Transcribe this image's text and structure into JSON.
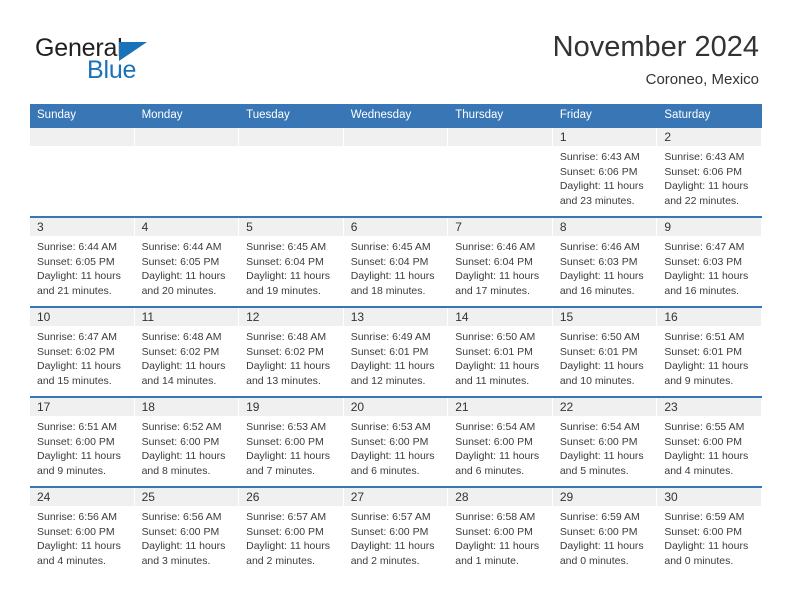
{
  "brand": {
    "name_part1": "General",
    "name_part2": "Blue",
    "triangle_color": "#1a73b8"
  },
  "header": {
    "title": "November 2024",
    "subtitle": "Coroneo, Mexico"
  },
  "calendar": {
    "accent_color": "#3876b5",
    "band_color": "#f0f0f0",
    "weekday_headers": [
      "Sunday",
      "Monday",
      "Tuesday",
      "Wednesday",
      "Thursday",
      "Friday",
      "Saturday"
    ],
    "weeks": [
      [
        {
          "day": "",
          "sunrise": "",
          "sunset": "",
          "daylight": ""
        },
        {
          "day": "",
          "sunrise": "",
          "sunset": "",
          "daylight": ""
        },
        {
          "day": "",
          "sunrise": "",
          "sunset": "",
          "daylight": ""
        },
        {
          "day": "",
          "sunrise": "",
          "sunset": "",
          "daylight": ""
        },
        {
          "day": "",
          "sunrise": "",
          "sunset": "",
          "daylight": ""
        },
        {
          "day": "1",
          "sunrise": "Sunrise: 6:43 AM",
          "sunset": "Sunset: 6:06 PM",
          "daylight": "Daylight: 11 hours and 23 minutes."
        },
        {
          "day": "2",
          "sunrise": "Sunrise: 6:43 AM",
          "sunset": "Sunset: 6:06 PM",
          "daylight": "Daylight: 11 hours and 22 minutes."
        }
      ],
      [
        {
          "day": "3",
          "sunrise": "Sunrise: 6:44 AM",
          "sunset": "Sunset: 6:05 PM",
          "daylight": "Daylight: 11 hours and 21 minutes."
        },
        {
          "day": "4",
          "sunrise": "Sunrise: 6:44 AM",
          "sunset": "Sunset: 6:05 PM",
          "daylight": "Daylight: 11 hours and 20 minutes."
        },
        {
          "day": "5",
          "sunrise": "Sunrise: 6:45 AM",
          "sunset": "Sunset: 6:04 PM",
          "daylight": "Daylight: 11 hours and 19 minutes."
        },
        {
          "day": "6",
          "sunrise": "Sunrise: 6:45 AM",
          "sunset": "Sunset: 6:04 PM",
          "daylight": "Daylight: 11 hours and 18 minutes."
        },
        {
          "day": "7",
          "sunrise": "Sunrise: 6:46 AM",
          "sunset": "Sunset: 6:04 PM",
          "daylight": "Daylight: 11 hours and 17 minutes."
        },
        {
          "day": "8",
          "sunrise": "Sunrise: 6:46 AM",
          "sunset": "Sunset: 6:03 PM",
          "daylight": "Daylight: 11 hours and 16 minutes."
        },
        {
          "day": "9",
          "sunrise": "Sunrise: 6:47 AM",
          "sunset": "Sunset: 6:03 PM",
          "daylight": "Daylight: 11 hours and 16 minutes."
        }
      ],
      [
        {
          "day": "10",
          "sunrise": "Sunrise: 6:47 AM",
          "sunset": "Sunset: 6:02 PM",
          "daylight": "Daylight: 11 hours and 15 minutes."
        },
        {
          "day": "11",
          "sunrise": "Sunrise: 6:48 AM",
          "sunset": "Sunset: 6:02 PM",
          "daylight": "Daylight: 11 hours and 14 minutes."
        },
        {
          "day": "12",
          "sunrise": "Sunrise: 6:48 AM",
          "sunset": "Sunset: 6:02 PM",
          "daylight": "Daylight: 11 hours and 13 minutes."
        },
        {
          "day": "13",
          "sunrise": "Sunrise: 6:49 AM",
          "sunset": "Sunset: 6:01 PM",
          "daylight": "Daylight: 11 hours and 12 minutes."
        },
        {
          "day": "14",
          "sunrise": "Sunrise: 6:50 AM",
          "sunset": "Sunset: 6:01 PM",
          "daylight": "Daylight: 11 hours and 11 minutes."
        },
        {
          "day": "15",
          "sunrise": "Sunrise: 6:50 AM",
          "sunset": "Sunset: 6:01 PM",
          "daylight": "Daylight: 11 hours and 10 minutes."
        },
        {
          "day": "16",
          "sunrise": "Sunrise: 6:51 AM",
          "sunset": "Sunset: 6:01 PM",
          "daylight": "Daylight: 11 hours and 9 minutes."
        }
      ],
      [
        {
          "day": "17",
          "sunrise": "Sunrise: 6:51 AM",
          "sunset": "Sunset: 6:00 PM",
          "daylight": "Daylight: 11 hours and 9 minutes."
        },
        {
          "day": "18",
          "sunrise": "Sunrise: 6:52 AM",
          "sunset": "Sunset: 6:00 PM",
          "daylight": "Daylight: 11 hours and 8 minutes."
        },
        {
          "day": "19",
          "sunrise": "Sunrise: 6:53 AM",
          "sunset": "Sunset: 6:00 PM",
          "daylight": "Daylight: 11 hours and 7 minutes."
        },
        {
          "day": "20",
          "sunrise": "Sunrise: 6:53 AM",
          "sunset": "Sunset: 6:00 PM",
          "daylight": "Daylight: 11 hours and 6 minutes."
        },
        {
          "day": "21",
          "sunrise": "Sunrise: 6:54 AM",
          "sunset": "Sunset: 6:00 PM",
          "daylight": "Daylight: 11 hours and 6 minutes."
        },
        {
          "day": "22",
          "sunrise": "Sunrise: 6:54 AM",
          "sunset": "Sunset: 6:00 PM",
          "daylight": "Daylight: 11 hours and 5 minutes."
        },
        {
          "day": "23",
          "sunrise": "Sunrise: 6:55 AM",
          "sunset": "Sunset: 6:00 PM",
          "daylight": "Daylight: 11 hours and 4 minutes."
        }
      ],
      [
        {
          "day": "24",
          "sunrise": "Sunrise: 6:56 AM",
          "sunset": "Sunset: 6:00 PM",
          "daylight": "Daylight: 11 hours and 4 minutes."
        },
        {
          "day": "25",
          "sunrise": "Sunrise: 6:56 AM",
          "sunset": "Sunset: 6:00 PM",
          "daylight": "Daylight: 11 hours and 3 minutes."
        },
        {
          "day": "26",
          "sunrise": "Sunrise: 6:57 AM",
          "sunset": "Sunset: 6:00 PM",
          "daylight": "Daylight: 11 hours and 2 minutes."
        },
        {
          "day": "27",
          "sunrise": "Sunrise: 6:57 AM",
          "sunset": "Sunset: 6:00 PM",
          "daylight": "Daylight: 11 hours and 2 minutes."
        },
        {
          "day": "28",
          "sunrise": "Sunrise: 6:58 AM",
          "sunset": "Sunset: 6:00 PM",
          "daylight": "Daylight: 11 hours and 1 minute."
        },
        {
          "day": "29",
          "sunrise": "Sunrise: 6:59 AM",
          "sunset": "Sunset: 6:00 PM",
          "daylight": "Daylight: 11 hours and 0 minutes."
        },
        {
          "day": "30",
          "sunrise": "Sunrise: 6:59 AM",
          "sunset": "Sunset: 6:00 PM",
          "daylight": "Daylight: 11 hours and 0 minutes."
        }
      ]
    ]
  }
}
